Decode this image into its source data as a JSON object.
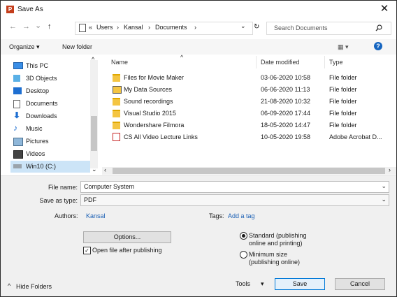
{
  "window": {
    "title": "Save As",
    "app_icon_letter": "P",
    "close_glyph": "✕"
  },
  "nav": {
    "back_glyph": "←",
    "forward_glyph": "→",
    "recent_glyph": "⌄",
    "up_glyph": "↑",
    "address": {
      "overflow": "«",
      "crumbs": [
        "Users",
        "Kansal",
        "Documents"
      ],
      "separator": "›",
      "dropdown_glyph": "⌄",
      "refresh_glyph": "↻"
    },
    "search": {
      "placeholder": "Search Documents",
      "icon": "search-icon"
    }
  },
  "toolbar": {
    "organize_label": "Organize ▾",
    "new_folder_label": "New folder",
    "view_glyph": "▦ ▾",
    "help_glyph": "?"
  },
  "sidebar": {
    "items": [
      {
        "label": "This PC",
        "icon": "computer-icon"
      },
      {
        "label": "3D Objects",
        "icon": "cube-icon"
      },
      {
        "label": "Desktop",
        "icon": "desktop-icon"
      },
      {
        "label": "Documents",
        "icon": "document-icon"
      },
      {
        "label": "Downloads",
        "icon": "download-icon"
      },
      {
        "label": "Music",
        "icon": "music-icon"
      },
      {
        "label": "Pictures",
        "icon": "pictures-icon"
      },
      {
        "label": "Videos",
        "icon": "videos-icon"
      },
      {
        "label": "Win10 (C:)",
        "icon": "drive-icon"
      }
    ],
    "selected_index": 8
  },
  "file_list": {
    "columns": {
      "name": "Name",
      "date": "Date modified",
      "type": "Type"
    },
    "sort_glyph": "^",
    "rows": [
      {
        "name": "Files for Movie Maker",
        "date": "03-06-2020 10:58",
        "type": "File folder",
        "icon": "folder-icon"
      },
      {
        "name": "My Data Sources",
        "date": "06-06-2020 11:13",
        "type": "File folder",
        "icon": "data-sources-icon"
      },
      {
        "name": "Sound recordings",
        "date": "21-08-2020 10:32",
        "type": "File folder",
        "icon": "folder-icon"
      },
      {
        "name": "Visual Studio 2015",
        "date": "06-09-2020 17:44",
        "type": "File folder",
        "icon": "folder-icon"
      },
      {
        "name": "Wondershare Filmora",
        "date": "18-05-2020 14:47",
        "type": "File folder",
        "icon": "folder-icon"
      },
      {
        "name": "CS All Video Lecture Links",
        "date": "10-05-2020 19:58",
        "type": "Adobe Acrobat D...",
        "icon": "pdf-icon"
      }
    ]
  },
  "form": {
    "file_name_label": "File name:",
    "file_name_value": "Computer System",
    "save_as_type_label": "Save as type:",
    "save_as_type_value": "PDF",
    "authors_label": "Authors:",
    "authors_value": "Kansal",
    "tags_label": "Tags:",
    "tags_value": "Add a tag",
    "options_label": "Options...",
    "open_after_label": "Open file after publishing",
    "open_after_checked": true,
    "optimize_standard_line1": "Standard (publishing",
    "optimize_standard_line2": "online and printing)",
    "optimize_min_line1": "Minimum size",
    "optimize_min_line2": "(publishing online)",
    "optimize_selected": "standard"
  },
  "footer": {
    "hide_folders_label": "Hide Folders",
    "hide_folders_glyph": "^",
    "tools_label": "Tools",
    "tools_glyph": "▾",
    "save_label": "Save",
    "cancel_label": "Cancel"
  }
}
